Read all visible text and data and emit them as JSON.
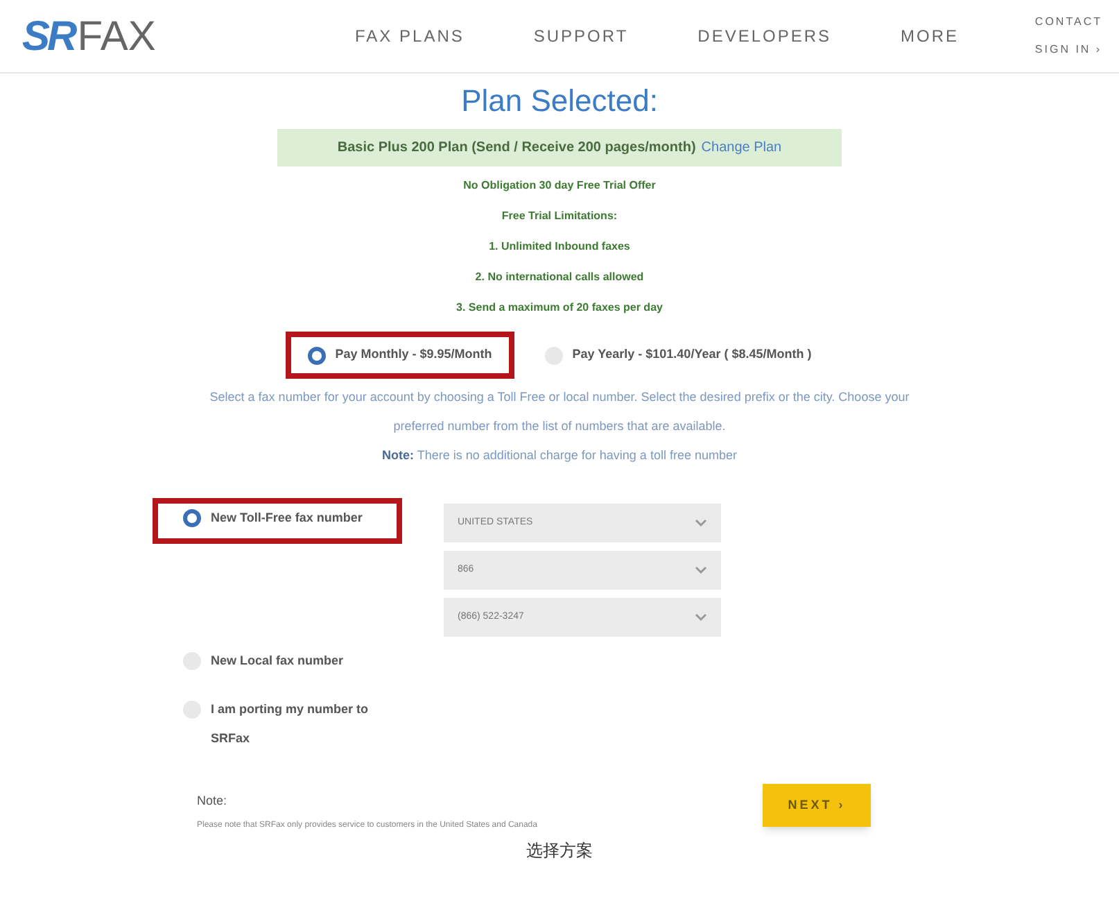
{
  "logo": {
    "bold": "SR",
    "light": "FAX"
  },
  "nav": [
    "FAX PLANS",
    "SUPPORT",
    "DEVELOPERS",
    "MORE"
  ],
  "header_links": {
    "contact": "CONTACT",
    "sign_in": "SIGN IN",
    "sign_in_arrow": "›"
  },
  "title": "Plan Selected:",
  "plan": {
    "text": "Basic Plus 200 Plan (Send / Receive 200 pages/month)",
    "link": "Change Plan"
  },
  "trial_lines": [
    "No Obligation 30 day Free Trial Offer",
    "Free Trial Limitations:",
    "1. Unlimited Inbound faxes",
    "2. No international calls allowed",
    "3. Send a maximum of 20 faxes per day"
  ],
  "billing_options": [
    {
      "label": "Pay Monthly - $9.95/Month",
      "selected": true,
      "highlighted": true
    },
    {
      "label": "Pay Yearly - $101.40/Year ( $8.45/Month )",
      "selected": false,
      "highlighted": false
    }
  ],
  "instructions": [
    "Select a fax number for your account by choosing a Toll Free or local number. Select the desired prefix or the city. Choose your preferred number from the list of numbers that are available.",
    "**Note:** There is no additional charge for having a toll free number"
  ],
  "number_options": [
    {
      "label": "New Toll-Free fax number",
      "selected": true,
      "highlighted": true
    },
    {
      "label": "New Local fax number",
      "selected": false,
      "highlighted": false
    },
    {
      "label": "I am porting my number to SRFax",
      "selected": false,
      "highlighted": false
    }
  ],
  "selects": [
    "UNITED STATES",
    "866",
    "(866) 522-3247"
  ],
  "footer_note": {
    "heading": "Note:",
    "text": "Please note that SRFax only provides service to customers in the United States and Canada"
  },
  "next_button": {
    "label": "NEXT",
    "arrow": "›"
  },
  "caption": "选择方案"
}
